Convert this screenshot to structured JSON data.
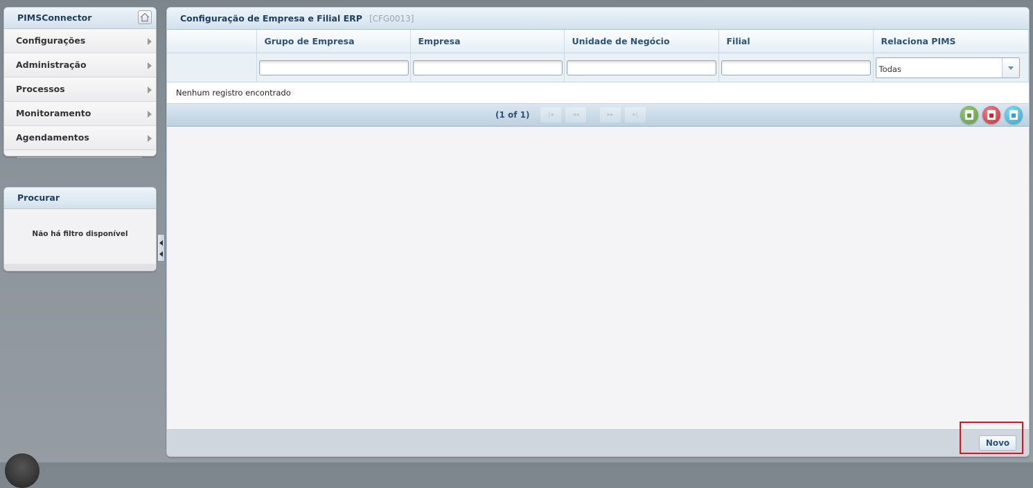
{
  "sidebar": {
    "title": "PIMSConnector",
    "items": [
      {
        "label": "Configurações"
      },
      {
        "label": "Administração"
      },
      {
        "label": "Processos"
      },
      {
        "label": "Monitoramento"
      },
      {
        "label": "Agendamentos"
      }
    ]
  },
  "search_panel": {
    "title": "Procurar",
    "empty_text": "Não há filtro disponível"
  },
  "main": {
    "title": "Configuração de Empresa e Filial ERP",
    "code": "[CFG0013]",
    "columns": [
      "",
      "Grupo de Empresa",
      "Empresa",
      "Unidade de Negócio",
      "Filial",
      "Relaciona PIMS"
    ],
    "filters": {
      "relaciona_pims_selected": "Todas"
    },
    "empty_message": "Nenhum registro encontrado",
    "paginator": {
      "page_report": "(1 of 1)",
      "first": "|◂",
      "prev": "◂◂",
      "next": "▸▸",
      "last": "▸|"
    },
    "export_icons": [
      "export-excel-icon",
      "export-pdf-icon",
      "export-csv-icon"
    ],
    "colors": {
      "excel": "#6aa84f",
      "pdf": "#d9363e",
      "csv": "#3cb6d6"
    },
    "footer": {
      "new_button_label": "Novo"
    }
  }
}
